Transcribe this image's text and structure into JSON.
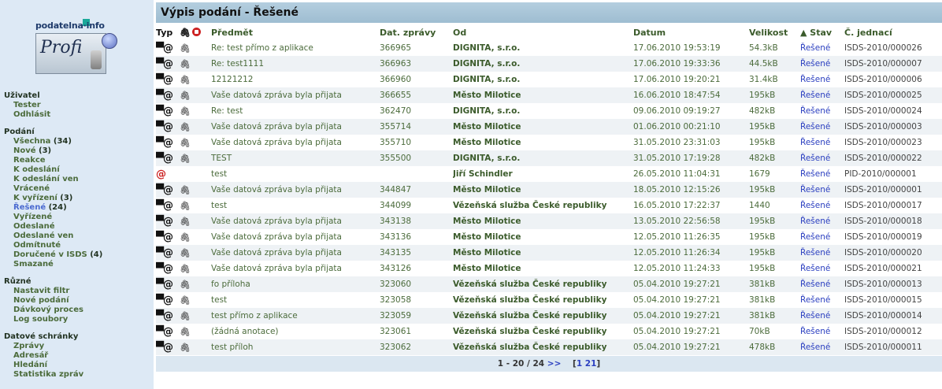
{
  "logo": {
    "top_text": "podatelna·info",
    "brand": "Profi"
  },
  "title": "Výpis podání - Řešené",
  "sidebar": {
    "sections": [
      {
        "heading": "Uživatel",
        "items": [
          {
            "label": "Tester"
          },
          {
            "label": "Odhlásit"
          }
        ]
      },
      {
        "heading": "Podání",
        "items": [
          {
            "label": "Všechna",
            "count": "(34)"
          },
          {
            "label": "Nové",
            "count": "(3)"
          },
          {
            "label": "Reakce"
          },
          {
            "label": "K odeslání"
          },
          {
            "label": "K odeslání ven"
          },
          {
            "label": "Vrácené"
          },
          {
            "label": "K vyřízení",
            "count": "(3)"
          },
          {
            "label": "Řešené",
            "count": "(24)",
            "active": true
          },
          {
            "label": "Vyřízené"
          },
          {
            "label": "Odeslané"
          },
          {
            "label": "Odeslané ven"
          },
          {
            "label": "Odmítnuté"
          },
          {
            "label": "Doručené v ISDS",
            "count": "(4)"
          },
          {
            "label": "Smazané"
          }
        ]
      },
      {
        "heading": "Různé",
        "items": [
          {
            "label": "Nastavit filtr"
          },
          {
            "label": "Nové podání"
          },
          {
            "label": "Dávkový proces"
          },
          {
            "label": "Log soubory"
          }
        ]
      },
      {
        "heading": "Datové schránky",
        "items": [
          {
            "label": "Zprávy"
          },
          {
            "label": "Adresář"
          },
          {
            "label": "Hledání"
          },
          {
            "label": "Statistika zpráv"
          }
        ]
      }
    ]
  },
  "table": {
    "headers": {
      "type": "Typ",
      "subject": "Předmět",
      "msg_date": "Dat. zprávy",
      "from": "Od",
      "date": "Datum",
      "size": "Velikost",
      "state": "▲ Stav",
      "ref": "Č. jednací"
    },
    "rows": [
      {
        "type": "datova",
        "attach": true,
        "subject": "Re: test přímo z aplikace",
        "msg": "366965",
        "from": "DIGNITA, s.r.o.",
        "date": "17.06.2010 19:53:19",
        "size": "54.3kB",
        "state": "Řešené",
        "ref": "ISDS-2010/000026"
      },
      {
        "type": "datova",
        "attach": true,
        "subject": "Re: test1111",
        "msg": "366963",
        "from": "DIGNITA, s.r.o.",
        "date": "17.06.2010 19:33:36",
        "size": "44.5kB",
        "state": "Řešené",
        "ref": "ISDS-2010/000007"
      },
      {
        "type": "datova",
        "attach": true,
        "subject": "12121212",
        "msg": "366960",
        "from": "DIGNITA, s.r.o.",
        "date": "17.06.2010 19:20:21",
        "size": "31.4kB",
        "state": "Řešené",
        "ref": "ISDS-2010/000006"
      },
      {
        "type": "datova",
        "attach": true,
        "subject": "Vaše datová zpráva byla přijata",
        "msg": "366655",
        "from": "Město Milotice",
        "date": "16.06.2010 18:47:54",
        "size": "195kB",
        "state": "Řešené",
        "ref": "ISDS-2010/000025"
      },
      {
        "type": "datova",
        "attach": true,
        "subject": "Re: test",
        "msg": "362470",
        "from": "DIGNITA, s.r.o.",
        "date": "09.06.2010 09:19:27",
        "size": "482kB",
        "state": "Řešené",
        "ref": "ISDS-2010/000024"
      },
      {
        "type": "datova",
        "attach": true,
        "subject": "Vaše datová zpráva byla přijata",
        "msg": "355714",
        "from": "Město Milotice",
        "date": "01.06.2010 00:21:10",
        "size": "195kB",
        "state": "Řešené",
        "ref": "ISDS-2010/000003"
      },
      {
        "type": "datova",
        "attach": true,
        "subject": "Vaše datová zpráva byla přijata",
        "msg": "355710",
        "from": "Město Milotice",
        "date": "31.05.2010 23:31:03",
        "size": "195kB",
        "state": "Řešené",
        "ref": "ISDS-2010/000023"
      },
      {
        "type": "datova",
        "attach": true,
        "subject": "TEST",
        "msg": "355500",
        "from": "DIGNITA, s.r.o.",
        "date": "31.05.2010 17:19:28",
        "size": "482kB",
        "state": "Řešené",
        "ref": "ISDS-2010/000022"
      },
      {
        "type": "email",
        "attach": false,
        "subject": "test",
        "msg": "",
        "from": "Jiří Schindler",
        "date": "26.05.2010 11:04:31",
        "size": "1679",
        "state": "Řešené",
        "ref": "PID-2010/000001"
      },
      {
        "type": "datova",
        "attach": true,
        "subject": "Vaše datová zpráva byla přijata",
        "msg": "344847",
        "from": "Město Milotice",
        "date": "18.05.2010 12:15:26",
        "size": "195kB",
        "state": "Řešené",
        "ref": "ISDS-2010/000001"
      },
      {
        "type": "datova",
        "attach": true,
        "subject": "test",
        "msg": "344099",
        "from": "Vězeňská služba České republiky",
        "date": "16.05.2010 17:22:37",
        "size": "1440",
        "state": "Řešené",
        "ref": "ISDS-2010/000017"
      },
      {
        "type": "datova",
        "attach": true,
        "subject": "Vaše datová zpráva byla přijata",
        "msg": "343138",
        "from": "Město Milotice",
        "date": "13.05.2010 22:56:58",
        "size": "195kB",
        "state": "Řešené",
        "ref": "ISDS-2010/000018"
      },
      {
        "type": "datova",
        "attach": true,
        "subject": "Vaše datová zpráva byla přijata",
        "msg": "343136",
        "from": "Město Milotice",
        "date": "12.05.2010 11:26:35",
        "size": "195kB",
        "state": "Řešené",
        "ref": "ISDS-2010/000019"
      },
      {
        "type": "datova",
        "attach": true,
        "subject": "Vaše datová zpráva byla přijata",
        "msg": "343135",
        "from": "Město Milotice",
        "date": "12.05.2010 11:26:34",
        "size": "195kB",
        "state": "Řešené",
        "ref": "ISDS-2010/000020"
      },
      {
        "type": "datova",
        "attach": true,
        "subject": "Vaše datová zpráva byla přijata",
        "msg": "343126",
        "from": "Město Milotice",
        "date": "12.05.2010 11:24:33",
        "size": "195kB",
        "state": "Řešené",
        "ref": "ISDS-2010/000021"
      },
      {
        "type": "datova",
        "attach": true,
        "subject": "fo příloha",
        "msg": "323060",
        "from": "Vězeňská služba České republiky",
        "date": "05.04.2010 19:27:21",
        "size": "381kB",
        "state": "Řešené",
        "ref": "ISDS-2010/000013"
      },
      {
        "type": "datova",
        "attach": true,
        "subject": "test",
        "msg": "323058",
        "from": "Vězeňská služba České republiky",
        "date": "05.04.2010 19:27:21",
        "size": "381kB",
        "state": "Řešené",
        "ref": "ISDS-2010/000015"
      },
      {
        "type": "datova",
        "attach": true,
        "subject": "test přímo z aplikace",
        "msg": "323059",
        "from": "Vězeňská služba České republiky",
        "date": "05.04.2010 19:27:21",
        "size": "381kB",
        "state": "Řešené",
        "ref": "ISDS-2010/000014"
      },
      {
        "type": "datova",
        "attach": true,
        "subject": "(žádná anotace)",
        "msg": "323061",
        "from": "Vězeňská služba České republiky",
        "date": "05.04.2010 19:27:21",
        "size": "70kB",
        "state": "Řešené",
        "ref": "ISDS-2010/000012"
      },
      {
        "type": "datova",
        "attach": true,
        "subject": "test příloh",
        "msg": "323062",
        "from": "Vězeňská služba České republiky",
        "date": "05.04.2010 19:27:21",
        "size": "478kB",
        "state": "Řešené",
        "ref": "ISDS-2010/000011"
      }
    ]
  },
  "pager": {
    "range": "1 - 20 / 24",
    "next": ">>",
    "pages_open": "[",
    "page1": "1",
    "page2": "21",
    "pages_close": "]"
  }
}
